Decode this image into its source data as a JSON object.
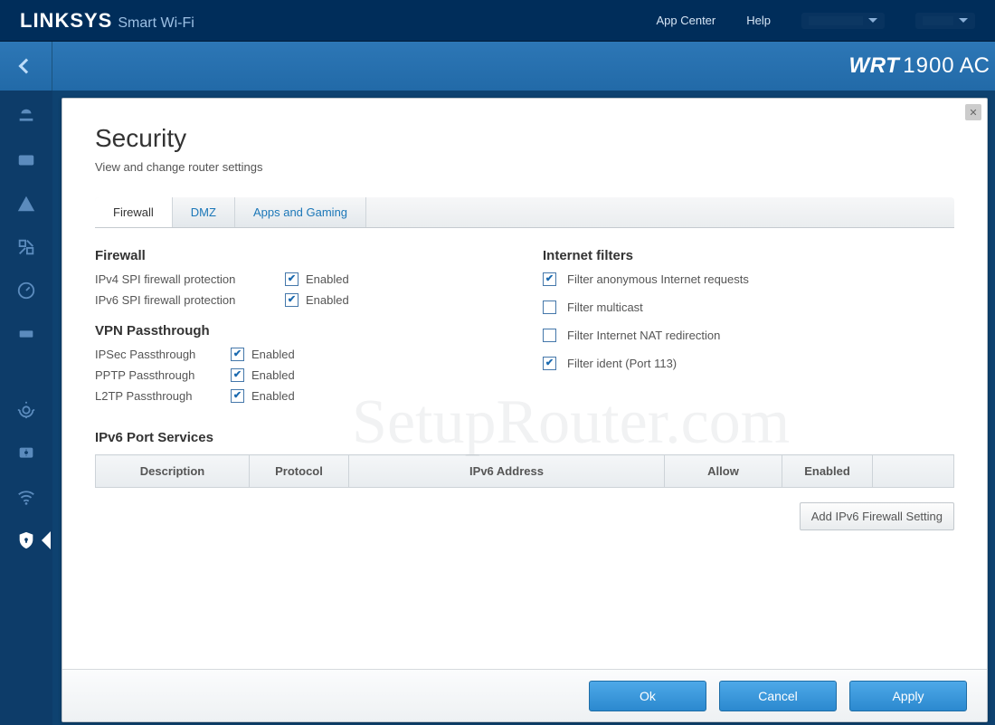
{
  "top": {
    "logo_main": "LINKSYS",
    "logo_sub": "Smart Wi-Fi",
    "nav": {
      "appcenter": "App Center",
      "help": "Help"
    }
  },
  "banner": {
    "model_prefix": "WRT",
    "model_number": "1900",
    "model_suffix": "AC"
  },
  "page": {
    "title": "Security",
    "subtitle": "View and change router settings",
    "tabs": {
      "firewall": "Firewall",
      "dmz": "DMZ",
      "apps": "Apps and Gaming"
    }
  },
  "firewall": {
    "heading": "Firewall",
    "ipv4_label": "IPv4 SPI firewall protection",
    "ipv4_enabled_label": "Enabled",
    "ipv6_label": "IPv6 SPI firewall protection",
    "ipv6_enabled_label": "Enabled"
  },
  "vpn": {
    "heading": "VPN Passthrough",
    "ipsec_label": "IPSec Passthrough",
    "ipsec_enabled_label": "Enabled",
    "pptp_label": "PPTP Passthrough",
    "pptp_enabled_label": "Enabled",
    "l2tp_label": "L2TP Passthrough",
    "l2tp_enabled_label": "Enabled"
  },
  "filters": {
    "heading": "Internet filters",
    "anon": "Filter anonymous Internet requests",
    "multicast": "Filter multicast",
    "nat": "Filter Internet NAT redirection",
    "ident": "Filter ident (Port 113)"
  },
  "ipv6": {
    "heading": "IPv6 Port Services",
    "cols": {
      "desc": "Description",
      "proto": "Protocol",
      "addr": "IPv6 Address",
      "allow": "Allow",
      "enabled": "Enabled"
    },
    "add_button": "Add IPv6 Firewall Setting"
  },
  "footer": {
    "ok": "Ok",
    "cancel": "Cancel",
    "apply": "Apply"
  },
  "watermark": "SetupRouter.com"
}
